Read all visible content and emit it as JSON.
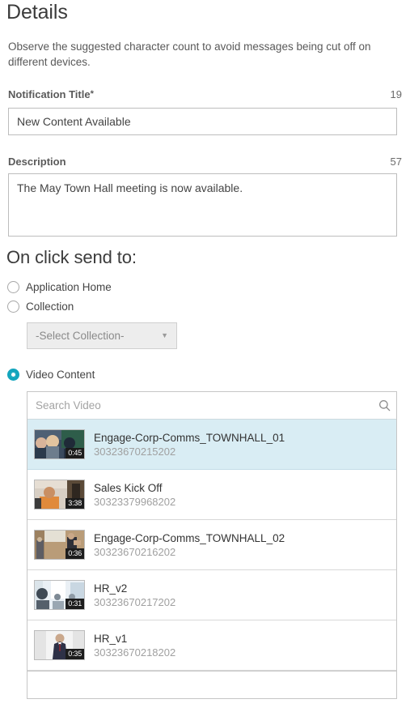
{
  "header": {
    "title": "Details",
    "intro": "Observe the suggested character count to avoid messages being cut off on different devices."
  },
  "form": {
    "notification_title": {
      "label": "Notification Title",
      "required_marker": "*",
      "char_count": "19",
      "value": "New Content Available",
      "placeholder": ""
    },
    "description": {
      "label": "Description",
      "char_count": "57",
      "value": "The May Town Hall meeting is now available.",
      "placeholder": ""
    }
  },
  "on_click": {
    "heading": "On click send to:",
    "options": [
      {
        "label": "Application Home",
        "selected": false
      },
      {
        "label": "Collection",
        "selected": false
      },
      {
        "label": "Video Content",
        "selected": true
      }
    ],
    "collection_select": {
      "value": "-Select Collection-",
      "caret": "▼"
    }
  },
  "video_picker": {
    "search": {
      "placeholder": "Search Video",
      "value": "",
      "icon": "search-icon"
    },
    "items": [
      {
        "title": "Engage-Corp-Comms_TOWNHALL_01",
        "id": "30323670215202",
        "duration": "0:45",
        "selected": true,
        "thumb_colors": [
          "#2f3f56",
          "#c9a98e",
          "#7f8fa0",
          "#3c5a72"
        ]
      },
      {
        "title": "Sales Kick Off",
        "id": "30323379968202",
        "duration": "3:38",
        "selected": false,
        "thumb_colors": [
          "#d8cfc4",
          "#e08a3c",
          "#4a4034",
          "#b9ab9a"
        ]
      },
      {
        "title": "Engage-Corp-Comms_TOWNHALL_02",
        "id": "30323670216202",
        "duration": "0:36",
        "selected": false,
        "thumb_colors": [
          "#b99c78",
          "#8a6f50",
          "#3a3a42",
          "#cdb796"
        ]
      },
      {
        "title": "HR_v2",
        "id": "30323670217202",
        "duration": "0:31",
        "selected": false,
        "thumb_colors": [
          "#dfe6ec",
          "#9fb4c4",
          "#55606b",
          "#eef3f7"
        ]
      },
      {
        "title": "HR_v1",
        "id": "30323670218202",
        "duration": "0:35",
        "selected": false,
        "thumb_colors": [
          "#f2f2f2",
          "#2e3147",
          "#c8c8c8",
          "#ffffff"
        ]
      }
    ]
  },
  "colors": {
    "accent": "#13a5bd",
    "selected_row": "#d9edf4",
    "border": "#c6c6c6",
    "text": "#444444",
    "muted_text": "#a0a0a0"
  }
}
